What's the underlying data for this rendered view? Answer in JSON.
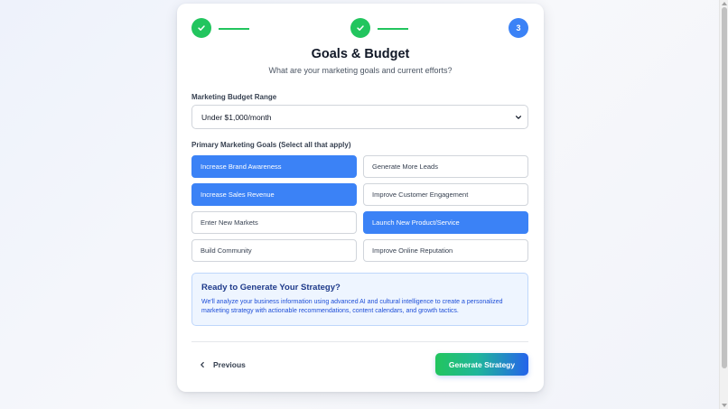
{
  "stepper": {
    "steps": [
      {
        "state": "done",
        "icon": "check-icon"
      },
      {
        "state": "done",
        "icon": "check-icon"
      },
      {
        "state": "active",
        "number": "3"
      }
    ],
    "colors": {
      "done": "#22c55e",
      "active": "#3b82f6"
    }
  },
  "header": {
    "title": "Goals & Budget",
    "subtitle": "What are your marketing goals and current efforts?"
  },
  "budget": {
    "label": "Marketing Budget Range",
    "selected": "Under $1,000/month"
  },
  "goals": {
    "label": "Primary Marketing Goals (Select all that apply)",
    "items": [
      {
        "label": "Increase Brand Awareness",
        "selected": true
      },
      {
        "label": "Generate More Leads",
        "selected": false
      },
      {
        "label": "Increase Sales Revenue",
        "selected": true
      },
      {
        "label": "Improve Customer Engagement",
        "selected": false
      },
      {
        "label": "Enter New Markets",
        "selected": false
      },
      {
        "label": "Launch New Product/Service",
        "selected": true
      },
      {
        "label": "Build Community",
        "selected": false
      },
      {
        "label": "Improve Online Reputation",
        "selected": false
      }
    ],
    "selected_color": "#3b82f6"
  },
  "info": {
    "title": "Ready to Generate Your Strategy?",
    "text": "We'll analyze your business information using advanced AI and cultural intelligence to create a personalized marketing strategy with actionable recommendations, content calendars, and growth tactics."
  },
  "footer": {
    "previous_label": "Previous",
    "generate_label": "Generate Strategy"
  }
}
